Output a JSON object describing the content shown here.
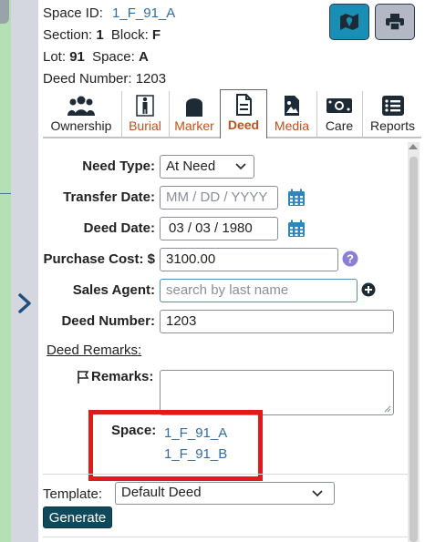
{
  "header": {
    "space_id_label": "Space ID:",
    "space_id_value": "1_F_91_A",
    "section_label": "Section:",
    "section_value": "1",
    "block_label": "Block:",
    "block_value": "F",
    "lot_label": "Lot:",
    "lot_value": "91",
    "space_label": "Space:",
    "space_value": "A",
    "deed_number_label": "Deed Number:",
    "deed_number_value": "1203"
  },
  "tabs": [
    {
      "label": "Ownership",
      "icon": "people-icon"
    },
    {
      "label": "Burial",
      "icon": "person-standing-icon"
    },
    {
      "label": "Marker",
      "icon": "headstone-icon"
    },
    {
      "label": "Deed",
      "icon": "document-icon"
    },
    {
      "label": "Media",
      "icon": "image-file-icon"
    },
    {
      "label": "Care",
      "icon": "money-icon"
    },
    {
      "label": "Reports",
      "icon": "list-icon"
    }
  ],
  "form": {
    "need_type_label": "Need Type:",
    "need_type_value": "At Need",
    "transfer_date_label": "Transfer Date:",
    "transfer_date_placeholder": "MM / DD / YYYY",
    "deed_date_label": "Deed Date:",
    "deed_date_value": "03 / 03 / 1980",
    "purchase_cost_label": "Purchase Cost: $",
    "purchase_cost_value": "3100.00",
    "sales_agent_label": "Sales Agent:",
    "sales_agent_placeholder": "search by last name",
    "deed_number_label": "Deed Number:",
    "deed_number_value": "1203",
    "deed_remarks_label": "Deed Remarks:",
    "remarks_label": "Remarks:",
    "space_label": "Space:",
    "spaces": [
      "1_F_91_A",
      "1_F_91_B"
    ],
    "template_label": "Template:",
    "template_value": "Default Deed",
    "generate_label": "Generate"
  },
  "colors": {
    "accent_orange": "#c0501c",
    "link_blue": "#2e6da4",
    "highlight_red": "#e01b1b",
    "generate_bg": "#0f4a5c",
    "map_button": "#1a8fb5"
  }
}
